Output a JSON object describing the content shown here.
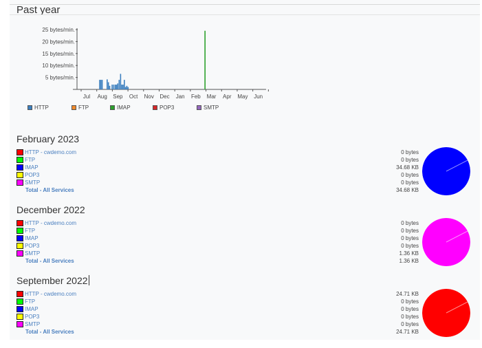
{
  "page_title": "Past year",
  "chart_data": {
    "type": "bar",
    "ylim": [
      0,
      25
    ],
    "y_ticks": [
      "25 bytes/min.",
      "20 bytes/min.",
      "15 bytes/min.",
      "10 bytes/min.",
      "5 bytes/min."
    ],
    "x_ticks": [
      "Jul",
      "Aug",
      "Sep",
      "Oct",
      "Nov",
      "Dec",
      "Jan",
      "Feb",
      "Mar",
      "Apr",
      "May",
      "Jun"
    ],
    "series": [
      {
        "name": "HTTP",
        "color": "#3b7fbf",
        "points": [
          {
            "x": 1.3,
            "y": 4.0
          },
          {
            "x": 1.38,
            "y": 4.0
          },
          {
            "x": 1.46,
            "y": 4.0
          },
          {
            "x": 1.78,
            "y": 4.2
          },
          {
            "x": 1.86,
            "y": 3.0
          },
          {
            "x": 1.94,
            "y": 1.5
          },
          {
            "x": 2.1,
            "y": 2.0
          },
          {
            "x": 2.2,
            "y": 2.0
          },
          {
            "x": 2.3,
            "y": 2.0
          },
          {
            "x": 2.38,
            "y": 2.0
          },
          {
            "x": 2.46,
            "y": 2.5
          },
          {
            "x": 2.55,
            "y": 4.0
          },
          {
            "x": 2.64,
            "y": 6.5
          },
          {
            "x": 2.72,
            "y": 2.0
          },
          {
            "x": 2.8,
            "y": 2.0
          },
          {
            "x": 2.88,
            "y": 4.0
          },
          {
            "x": 2.96,
            "y": 1.0
          },
          {
            "x": 3.04,
            "y": 1.5
          },
          {
            "x": 3.12,
            "y": 1.0
          }
        ]
      },
      {
        "name": "FTP",
        "color": "#f08a2c",
        "points": []
      },
      {
        "name": "IMAP",
        "color": "#2ca02c",
        "points": [
          {
            "x": 8.05,
            "y": 24.5
          }
        ]
      },
      {
        "name": "POP3",
        "color": "#d62728",
        "points": []
      },
      {
        "name": "SMTP",
        "color": "#9467bd",
        "points": []
      }
    ]
  },
  "months": [
    {
      "title": "February 2023",
      "rows": [
        {
          "label": "HTTP - cwdemo.com",
          "color": "#ff0000",
          "value": "0 bytes"
        },
        {
          "label": "FTP",
          "color": "#00ff00",
          "value": "0 bytes"
        },
        {
          "label": "IMAP",
          "color": "#0000ff",
          "value": "34.68 KB"
        },
        {
          "label": "POP3",
          "color": "#ffff00",
          "value": "0 bytes"
        },
        {
          "label": "SMTP",
          "color": "#ff00ff",
          "value": "0 bytes"
        }
      ],
      "total_label": "Total - All Services",
      "total_value": "34.68 KB",
      "pie_color": "#0000ff"
    },
    {
      "title": "December 2022",
      "rows": [
        {
          "label": "HTTP - cwdemo.com",
          "color": "#ff0000",
          "value": "0 bytes"
        },
        {
          "label": "FTP",
          "color": "#00ff00",
          "value": "0 bytes"
        },
        {
          "label": "IMAP",
          "color": "#0000ff",
          "value": "0 bytes"
        },
        {
          "label": "POP3",
          "color": "#ffff00",
          "value": "0 bytes"
        },
        {
          "label": "SMTP",
          "color": "#ff00ff",
          "value": "1.36 KB"
        }
      ],
      "total_label": "Total - All Services",
      "total_value": "1.36 KB",
      "pie_color": "#ff00ff"
    },
    {
      "title": "September 2022",
      "rows": [
        {
          "label": "HTTP - cwdemo.com",
          "color": "#ff0000",
          "value": "24.71 KB"
        },
        {
          "label": "FTP",
          "color": "#00ff00",
          "value": "0 bytes"
        },
        {
          "label": "IMAP",
          "color": "#0000ff",
          "value": "0 bytes"
        },
        {
          "label": "POP3",
          "color": "#ffff00",
          "value": "0 bytes"
        },
        {
          "label": "SMTP",
          "color": "#ff00ff",
          "value": "0 bytes"
        }
      ],
      "total_label": "Total - All Services",
      "total_value": "24.71 KB",
      "pie_color": "#ff0000"
    }
  ]
}
